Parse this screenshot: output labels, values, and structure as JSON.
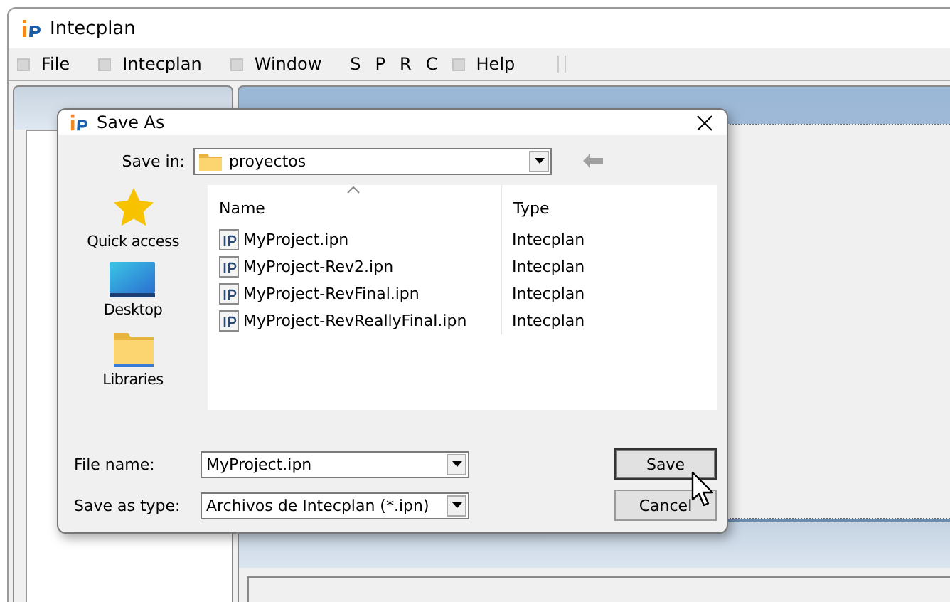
{
  "window": {
    "title": "Intecplan"
  },
  "menu": [
    {
      "label": "File",
      "kind": "icon"
    },
    {
      "label": "Intecplan",
      "kind": "icon"
    },
    {
      "label": "Window",
      "kind": "icon"
    },
    {
      "label": "S",
      "kind": "plain"
    },
    {
      "label": "P",
      "kind": "plain"
    },
    {
      "label": "R",
      "kind": "plain"
    },
    {
      "label": "C",
      "kind": "plain"
    },
    {
      "label": "Help",
      "kind": "icon"
    }
  ],
  "dialog": {
    "title": "Save As",
    "save_in": {
      "label": "Save in:",
      "value": "proyectos"
    },
    "places": [
      {
        "label": "Quick access",
        "kind": "star"
      },
      {
        "label": "Desktop",
        "kind": "desktop"
      },
      {
        "label": "Libraries",
        "kind": "folder"
      }
    ],
    "columns": [
      "Name",
      "Type"
    ],
    "rows": [
      {
        "name": "MyProject.ipn",
        "type": "Intecplan"
      },
      {
        "name": "MyProject-Rev2.ipn",
        "type": "Intecplan"
      },
      {
        "name": "MyProject-RevFinal.ipn",
        "type": "Intecplan"
      },
      {
        "name": "MyProject-RevReallyFinal.ipn",
        "type": "Intecplan"
      }
    ],
    "file_name": {
      "label": "File name:",
      "value": "MyProject.ipn"
    },
    "save_as_type": {
      "label": "Save as type:",
      "value": "Archivos de Intecplan (*.ipn)"
    },
    "buttons": [
      "Save",
      "Cancel"
    ]
  }
}
